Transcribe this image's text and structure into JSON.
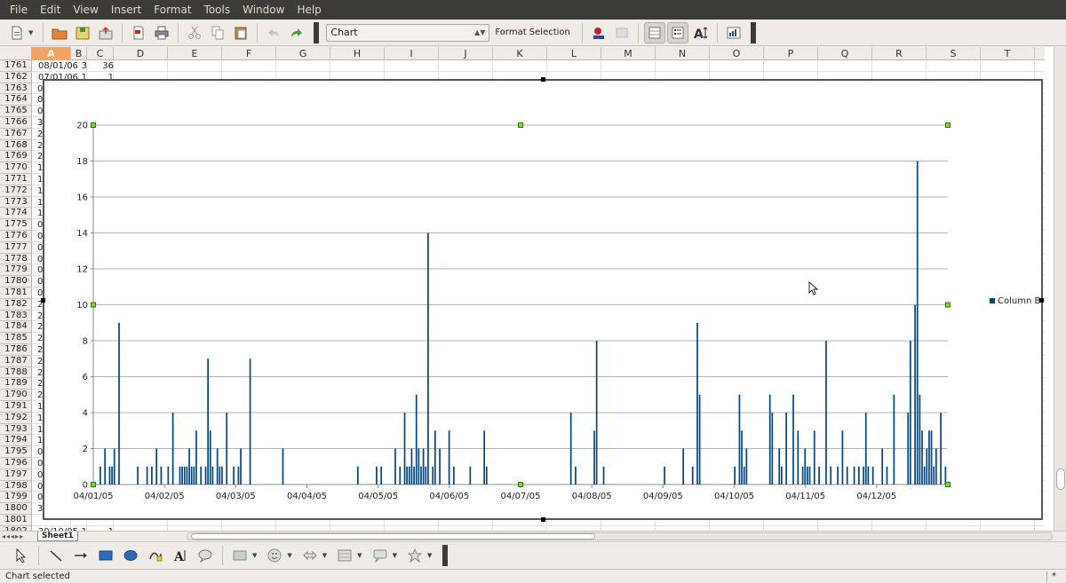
{
  "menubar": {
    "items": [
      "File",
      "Edit",
      "View",
      "Insert",
      "Format",
      "Tools",
      "Window",
      "Help"
    ]
  },
  "toolbar": {
    "chart_combo_value": "Chart",
    "format_selection_label": "Format Selection"
  },
  "sheet": {
    "columns": [
      "A",
      "B",
      "C",
      "D",
      "E",
      "F",
      "G",
      "H",
      "I",
      "J",
      "K",
      "L",
      "M",
      "N",
      "O",
      "P",
      "Q",
      "R",
      "S",
      "T"
    ],
    "active_column": "A",
    "row_numbers": [
      "1761",
      "1762",
      "1763",
      "1764",
      "1765",
      "1766",
      "1767",
      "1768",
      "1769",
      "1770",
      "1771",
      "1772",
      "1773",
      "1774",
      "1775",
      "1776",
      "1777",
      "1778",
      "1779",
      "1780",
      "1781",
      "1782",
      "1783",
      "1784",
      "1785",
      "1786",
      "1787",
      "1788",
      "1789",
      "1790",
      "1791",
      "1792",
      "1793",
      "1794",
      "1795",
      "1796",
      "1797",
      "1798",
      "1799",
      "1800",
      "1801",
      "1802"
    ],
    "visible_cells": [
      {
        "a": "08/01/06",
        "b": "3",
        "c": "36"
      },
      {
        "a": "07/01/06",
        "b": "1",
        "c": "1"
      }
    ],
    "partial_col_a": [
      "0",
      "0",
      "0",
      "3",
      "2",
      "2",
      "2",
      "1",
      "1",
      "1",
      "1",
      "1",
      "0",
      "0",
      "0",
      "0",
      "0",
      "0",
      "0",
      "2",
      "2",
      "2",
      "2",
      "2",
      "2",
      "2",
      "2",
      "2",
      "1",
      "1",
      "1",
      "1",
      "0",
      "0",
      "0",
      "0",
      "0",
      "3"
    ],
    "last_row": {
      "a": "30/10/05",
      "b": "1",
      "c": "1"
    },
    "sheet_tab": "Sheet1"
  },
  "chart_data": {
    "type": "bar",
    "series": [
      {
        "name": "Column B"
      }
    ],
    "x_tick_labels": [
      "04/01/05",
      "04/02/05",
      "04/03/05",
      "04/04/05",
      "04/05/05",
      "04/06/05",
      "04/07/05",
      "04/08/05",
      "04/09/05",
      "04/10/05",
      "04/11/05",
      "04/12/05"
    ],
    "x": [
      3,
      5,
      7,
      8,
      9,
      11,
      19,
      23,
      25,
      27,
      29,
      32,
      34,
      37,
      38,
      39,
      40,
      41,
      42,
      43,
      44,
      46,
      48,
      49,
      50,
      51,
      53,
      54,
      55,
      57,
      60,
      62,
      63,
      67,
      81,
      113,
      121,
      123,
      129,
      131,
      133,
      134,
      135,
      136,
      137,
      138,
      139,
      140,
      141,
      142,
      143,
      145,
      146,
      148,
      152,
      154,
      161,
      167,
      168,
      204,
      206,
      214,
      215,
      218,
      244,
      252,
      256,
      258,
      259,
      274,
      276,
      277,
      278,
      279,
      289,
      290,
      293,
      294,
      296,
      299,
      301,
      303,
      304,
      305,
      306,
      308,
      310,
      313,
      315,
      318,
      320,
      322,
      325,
      327,
      329,
      330,
      331,
      333,
      337,
      339,
      342,
      348,
      349,
      351,
      352,
      353,
      354,
      355,
      356,
      357,
      358,
      359,
      360,
      362,
      364
    ],
    "values": [
      1,
      2,
      1,
      1,
      2,
      9,
      1,
      1,
      1,
      2,
      1,
      1,
      4,
      1,
      1,
      1,
      1,
      2,
      1,
      1,
      3,
      1,
      1,
      7,
      3,
      1,
      2,
      1,
      1,
      4,
      1,
      1,
      2,
      7,
      2,
      1,
      1,
      1,
      2,
      1,
      4,
      1,
      1,
      2,
      1,
      5,
      2,
      1,
      2,
      1,
      14,
      1,
      3,
      2,
      3,
      1,
      1,
      3,
      1,
      4,
      1,
      3,
      8,
      1,
      1,
      2,
      1,
      9,
      5,
      1,
      5,
      3,
      1,
      2,
      5,
      4,
      2,
      1,
      4,
      5,
      3,
      1,
      2,
      1,
      1,
      3,
      1,
      8,
      1,
      1,
      3,
      1,
      1,
      1,
      1,
      4,
      1,
      1,
      2,
      1,
      5,
      4,
      8,
      10,
      18,
      5,
      3,
      1,
      2,
      3,
      3,
      1,
      2,
      4,
      1
    ],
    "x_range": [
      0,
      365
    ],
    "ylim": [
      0,
      20
    ],
    "y_ticks": [
      0,
      2,
      4,
      6,
      8,
      10,
      12,
      14,
      16,
      18,
      20
    ],
    "grid": true,
    "legend_position": "right",
    "bar_color": "#004586"
  },
  "drawbar": {
    "icons": [
      "select-arrow-icon",
      "line-icon",
      "arrow-line-icon",
      "rectangle-icon",
      "ellipse-icon",
      "freeform-icon",
      "fontwork-icon",
      "callout-icon",
      "basic-shapes-icon",
      "symbol-shapes-icon",
      "block-arrows-icon",
      "flowchart-icon",
      "callouts-icon",
      "stars-icon"
    ]
  },
  "statusbar": {
    "text": "Chart selected",
    "marker": "*"
  }
}
